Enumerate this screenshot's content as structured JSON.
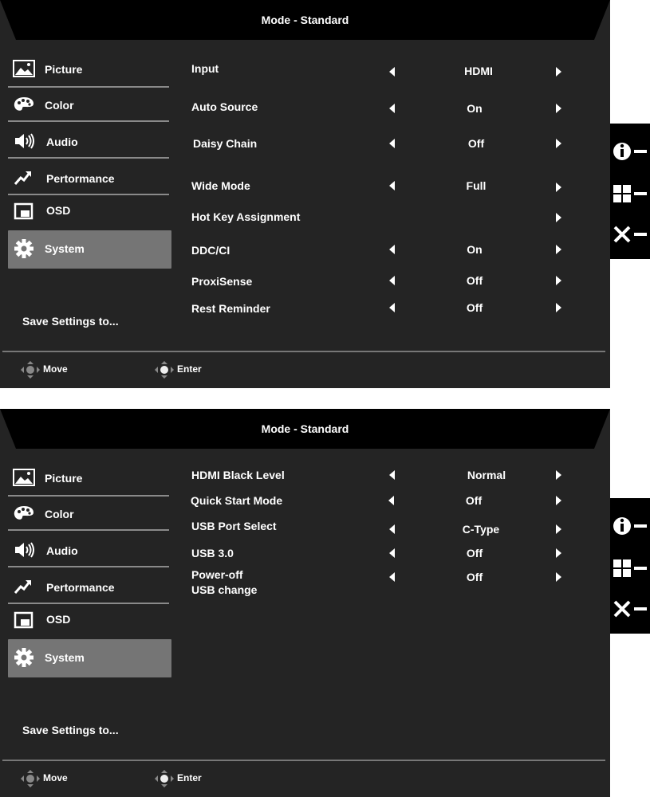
{
  "panel1": {
    "title": "Mode - Standard",
    "nav": [
      {
        "label": "Picture",
        "icon": "picture-icon"
      },
      {
        "label": "Color",
        "icon": "palette-icon"
      },
      {
        "label": "Audio",
        "icon": "speaker-icon"
      },
      {
        "label": "Pertormance",
        "icon": "performance-icon"
      },
      {
        "label": "OSD",
        "icon": "osd-icon"
      },
      {
        "label": "System",
        "icon": "gear-icon",
        "selected": true
      }
    ],
    "save_label": "Save Settings to...",
    "rows": [
      {
        "label": "Input",
        "value": "HDMI"
      },
      {
        "label": "Auto Source",
        "value": "On"
      },
      {
        "label": "Daisy Chain",
        "value": "Off"
      },
      {
        "label": "Wide Mode",
        "value": "Full"
      },
      {
        "label": "Hot Key Assignment",
        "value": ""
      },
      {
        "label": "DDC/CI",
        "value": "On"
      },
      {
        "label": "ProxiSense",
        "value": "Off"
      },
      {
        "label": "Rest Reminder",
        "value": "Off"
      }
    ],
    "hints": {
      "move": "Move",
      "enter": "Enter"
    }
  },
  "panel2": {
    "title": "Mode - Standard",
    "nav": [
      {
        "label": "Picture",
        "icon": "picture-icon"
      },
      {
        "label": "Color",
        "icon": "palette-icon"
      },
      {
        "label": "Audio",
        "icon": "speaker-icon"
      },
      {
        "label": "Pertormance",
        "icon": "performance-icon"
      },
      {
        "label": "OSD",
        "icon": "osd-icon"
      },
      {
        "label": "System",
        "icon": "gear-icon",
        "selected": true
      }
    ],
    "save_label": "Save Settings to...",
    "rows": [
      {
        "label": "HDMI Black Level",
        "value": "Normal"
      },
      {
        "label": "Quick Start Mode",
        "value": "Off"
      },
      {
        "label": "USB Port Select",
        "value": "C-Type"
      },
      {
        "label": "USB 3.0",
        "value": "Off"
      },
      {
        "label": "Power-off",
        "label2": "USB change",
        "value": "Off"
      }
    ],
    "hints": {
      "move": "Move",
      "enter": "Enter"
    }
  },
  "side_keys": [
    "info-key-icon",
    "mode-key-icon",
    "close-key-icon"
  ],
  "colors": {
    "panel_bg": "#242424",
    "title_bg": "#000000",
    "selected_bg": "#757575",
    "text": "#ffffff"
  }
}
